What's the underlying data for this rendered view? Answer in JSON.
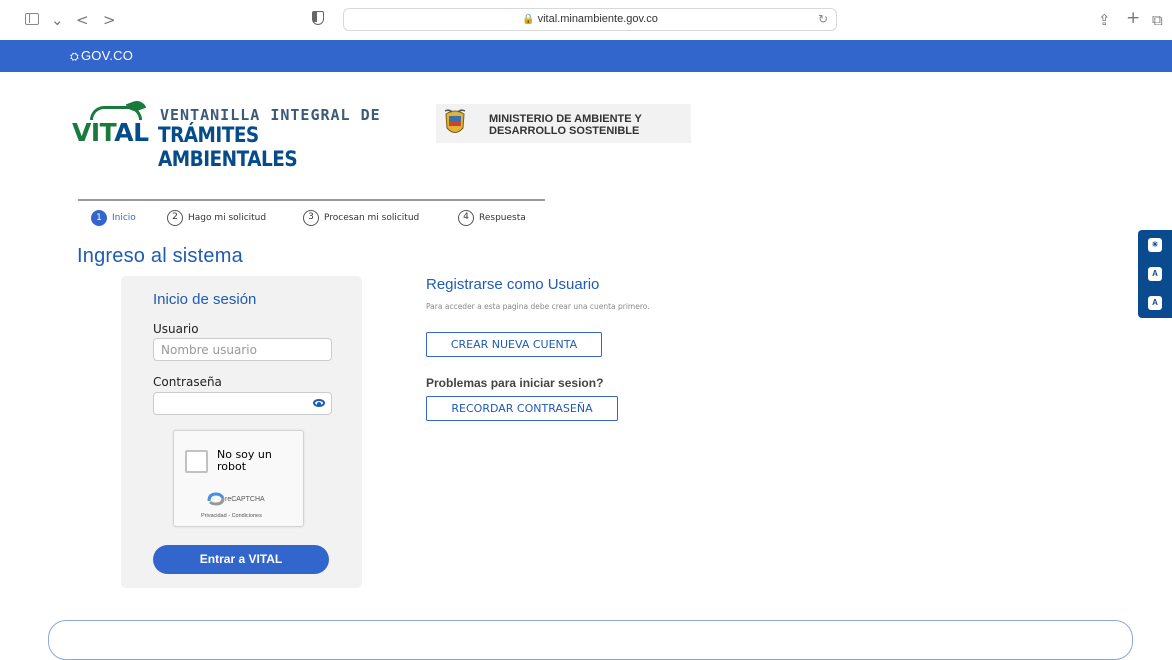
{
  "browser": {
    "url": "vital.minambiente.gov.co",
    "back_icon": "<",
    "forward_icon": ">",
    "chevron_icon": "⌄",
    "reload_icon": "↻",
    "share_icon": "⇪",
    "new_tab_icon": "+",
    "tabs_icon": "⧉"
  },
  "gov_bar": {
    "logo_text": "GOV.CO",
    "color": "#3366cc"
  },
  "header": {
    "vital_word_a": "VIT",
    "vital_word_b": "AL",
    "vital_line1": "VENTANILLA INTEGRAL DE",
    "vital_line2": "TRÁMITES AMBIENTALES",
    "ministry_line1": "MINISTERIO DE AMBIENTE Y",
    "ministry_line2": "DESARROLLO SOSTENIBLE"
  },
  "steps": [
    {
      "num": "1",
      "label": "Inicio"
    },
    {
      "num": "2",
      "label": "Hago mi solicitud"
    },
    {
      "num": "3",
      "label": "Procesan mi solicitud"
    },
    {
      "num": "4",
      "label": "Respuesta"
    }
  ],
  "page_title": "Ingreso al sistema",
  "login": {
    "title": "Inicio de sesión",
    "user_label": "Usuario",
    "user_placeholder": "Nombre usuario",
    "password_label": "Contraseña",
    "password_value": "",
    "captcha_text": "No soy un robot",
    "captcha_brand": "reCAPTCHA",
    "captcha_links": "Privacidad - Condiciones",
    "submit_label": "Entrar a VITAL"
  },
  "register": {
    "title": "Registrarse como Usuario",
    "subtitle": "Para acceder a esta pagina debe crear una cuenta primero.",
    "create_label": "CREAR NUEVA CUENTA",
    "problems_text": "Problemas para iniciar sesion?",
    "recover_label": "RECORDAR CONTRASEÑA"
  },
  "accessibility": {
    "tools": [
      "contrast-icon",
      "decrease-font-icon",
      "increase-font-icon"
    ],
    "glyphs": [
      "☀",
      "A",
      "A"
    ],
    "color": "#0a4a8f"
  },
  "colors": {
    "primary": "#3366cc",
    "title_blue": "#1f5bb5",
    "vital_green": "#1a7a3c"
  }
}
